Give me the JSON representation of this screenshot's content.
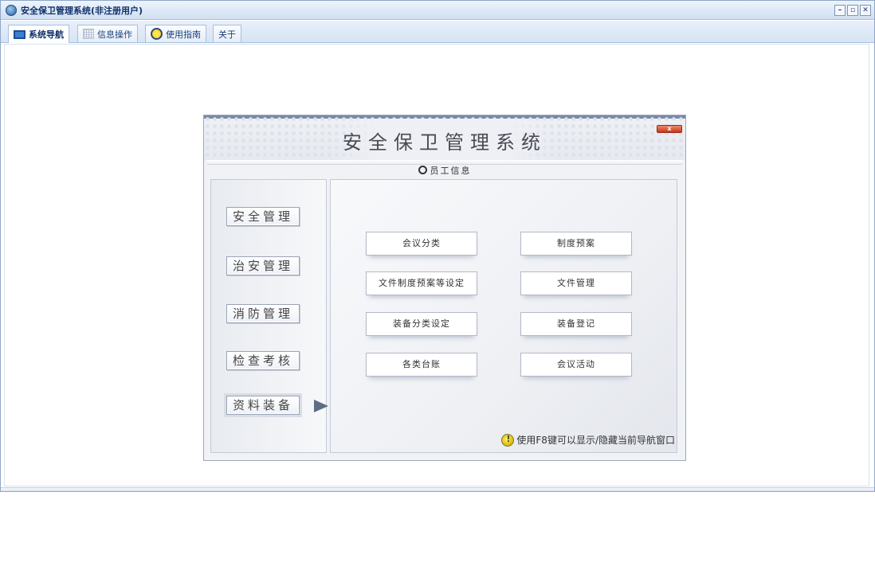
{
  "window": {
    "title": "安全保卫管理系统(非注册用户)",
    "controls": {
      "minimize": "–",
      "restore": "▫",
      "close": "✕"
    }
  },
  "tabs": [
    {
      "label": "系统导航",
      "icon": "monitor-icon",
      "active": true
    },
    {
      "label": "信息操作",
      "icon": "grid-icon",
      "active": false
    },
    {
      "label": "使用指南",
      "icon": "guide-icon",
      "active": false
    },
    {
      "label": "关于",
      "icon": "",
      "active": false
    }
  ],
  "nav": {
    "title": "安全保卫管理系统",
    "close_label": "x",
    "sub_heading": "员工信息",
    "side_menu": [
      {
        "label": "安全管理"
      },
      {
        "label": "治安管理"
      },
      {
        "label": "消防管理"
      },
      {
        "label": "检查考核"
      },
      {
        "label": "资料装备",
        "selected": true
      }
    ],
    "buttons": [
      {
        "label": "会议分类"
      },
      {
        "label": "制度预案"
      },
      {
        "label": "文件制度预案等设定"
      },
      {
        "label": "文件管理"
      },
      {
        "label": "装备分类设定"
      },
      {
        "label": "装备登记"
      },
      {
        "label": "各类台账"
      },
      {
        "label": "会议活动"
      }
    ],
    "hint": "使用F8键可以显示/隐藏当前导航窗口"
  }
}
